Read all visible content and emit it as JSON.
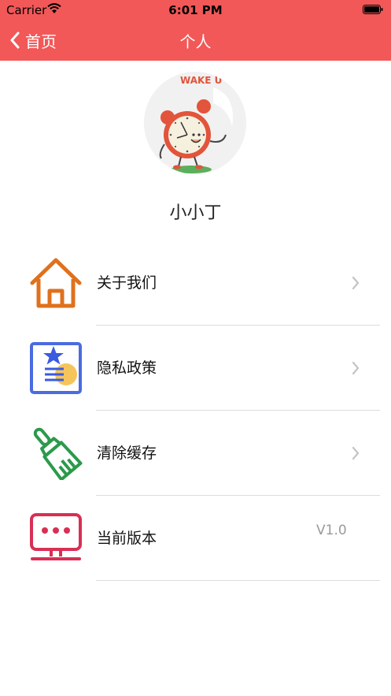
{
  "status_bar": {
    "carrier": "Carrier",
    "time": "6:01 PM"
  },
  "nav": {
    "back_label": "首页",
    "title": "个人"
  },
  "profile": {
    "avatar_text": "WAKE U",
    "name": "小小丁"
  },
  "menu": [
    {
      "label": "关于我们",
      "icon": "home-icon"
    },
    {
      "label": "隐私政策",
      "icon": "privacy-icon"
    },
    {
      "label": "清除缓存",
      "icon": "brush-icon"
    },
    {
      "label": "当前版本",
      "icon": "monitor-icon",
      "value": "V1.0"
    }
  ],
  "colors": {
    "header": "#f25858"
  }
}
